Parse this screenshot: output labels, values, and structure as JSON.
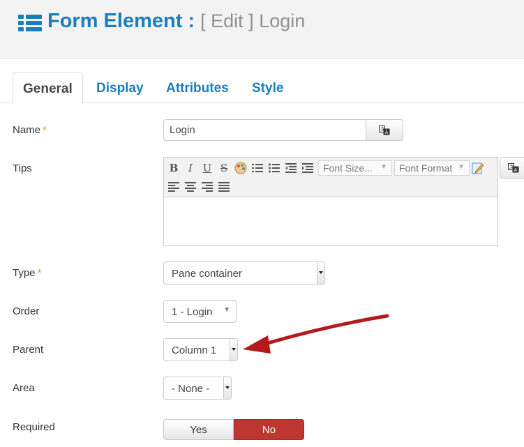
{
  "header": {
    "title": "Form Element :",
    "subtitle": "[ Edit ] Login",
    "icon": "list-icon",
    "title_color": "#1a7fbd"
  },
  "tabs": [
    {
      "label": "General",
      "active": true
    },
    {
      "label": "Display",
      "active": false
    },
    {
      "label": "Attributes",
      "active": false
    },
    {
      "label": "Style",
      "active": false
    }
  ],
  "fields": {
    "name": {
      "label": "Name",
      "required": "*",
      "value": "Login"
    },
    "tips": {
      "label": "Tips"
    },
    "type": {
      "label": "Type",
      "required": "*",
      "value": "Pane container"
    },
    "order": {
      "label": "Order",
      "value": "1 - Login"
    },
    "parent": {
      "label": "Parent",
      "value": "Column 1"
    },
    "area": {
      "label": "Area",
      "value": "- None -"
    },
    "required": {
      "label": "Required",
      "yes": "Yes",
      "no": "No",
      "selected": "No"
    }
  },
  "editor": {
    "font_size": "Font Size...",
    "font_format": "Font Format",
    "buttons": [
      "bold-icon",
      "italic-icon",
      "underline-icon",
      "strikethrough-icon",
      "color-palette-icon",
      "ordered-list-icon",
      "unordered-list-icon",
      "outdent-icon",
      "indent-icon",
      "edit-icon",
      "align-left-icon",
      "align-center-icon",
      "align-right-icon",
      "align-justify-icon"
    ]
  },
  "colors": {
    "accent": "#1a7fbd",
    "danger": "#bd362f",
    "required_star": "#e09a2c",
    "annotation_arrow": "#b31b1b"
  }
}
